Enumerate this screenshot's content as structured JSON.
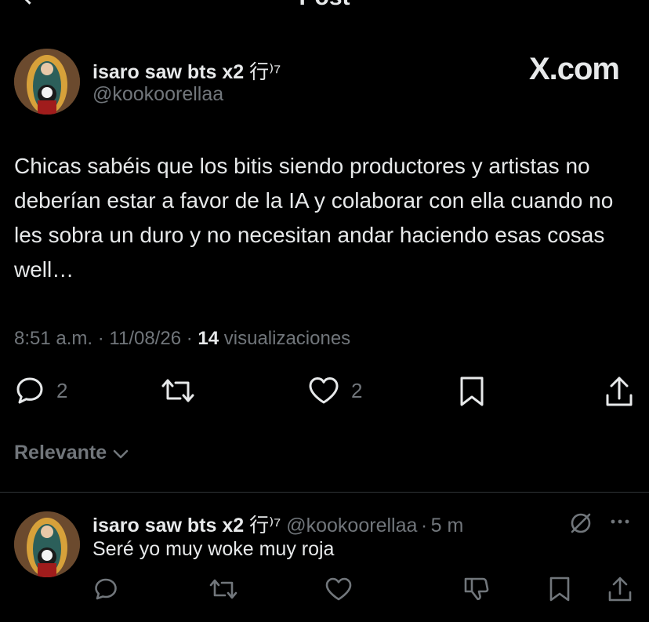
{
  "header": {
    "title": "Post"
  },
  "post": {
    "author_name": "isaro saw bts x2",
    "author_badge": "⾏⁾⁷",
    "handle": "@kookoorellaa",
    "brand": "X.com",
    "text": "Chicas sabéis que los bitis siendo productores y artistas no deberían estar a favor de la IA y colaborar con ella cuando no les sobra un duro y no necesitan andar haciendo esas cosas well…",
    "time": "8:51 a.m.",
    "date": "11/08/26",
    "views_count": "14",
    "views_label": "visualizaciones",
    "replies": "2",
    "likes": "2"
  },
  "sort": {
    "label": "Relevante"
  },
  "reply": {
    "author_name": "isaro saw bts x2",
    "author_badge": "⾏⁾⁷",
    "handle": "@kookoorellaa",
    "age": "5 m",
    "text": "Seré yo muy woke muy roja"
  },
  "colors": {
    "background": "#000000",
    "text": "#e7e9ea",
    "muted": "#71767b",
    "divider": "#2f3336"
  }
}
